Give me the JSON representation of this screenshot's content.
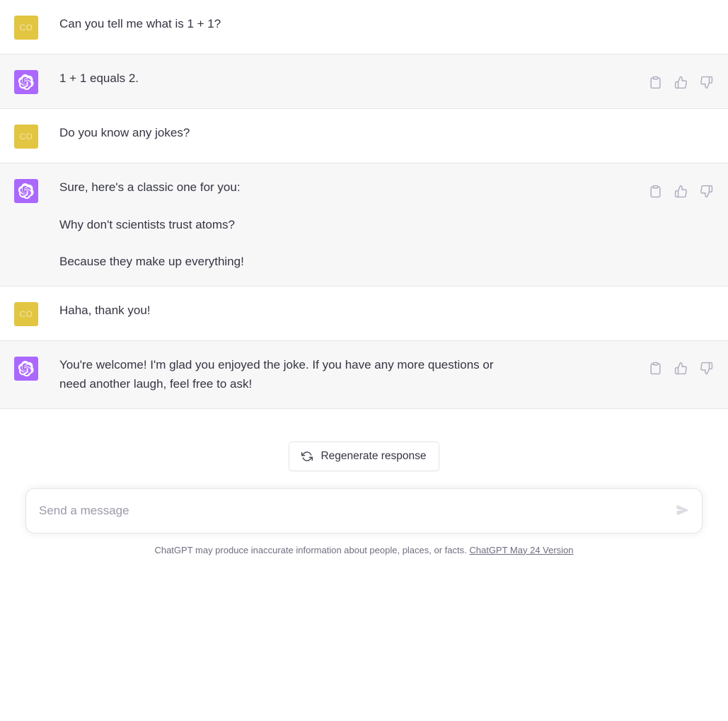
{
  "conversation": {
    "messages": [
      {
        "role": "user",
        "avatar_initials": "CO",
        "avatar_name": "user-avatar",
        "paragraphs": [
          "Can you tell me what is 1 + 1?"
        ]
      },
      {
        "role": "assistant",
        "avatar_name": "chatgpt-avatar",
        "paragraphs": [
          "1 + 1 equals 2."
        ]
      },
      {
        "role": "user",
        "avatar_initials": "CO",
        "avatar_name": "user-avatar",
        "paragraphs": [
          "Do you know any jokes?"
        ]
      },
      {
        "role": "assistant",
        "avatar_name": "chatgpt-avatar",
        "paragraphs": [
          "Sure, here's a classic one for you:",
          "Why don't scientists trust atoms?",
          "Because they make up everything!"
        ]
      },
      {
        "role": "user",
        "avatar_initials": "CO",
        "avatar_name": "user-avatar",
        "paragraphs": [
          "Haha, thank you!"
        ]
      },
      {
        "role": "assistant",
        "avatar_name": "chatgpt-avatar",
        "paragraphs": [
          "You're welcome! I'm glad you enjoyed the joke. If you have any more questions or need another laugh, feel free to ask!"
        ]
      }
    ],
    "message_actions": [
      {
        "name": "copy-icon",
        "label": "Copy"
      },
      {
        "name": "thumbs-up-icon",
        "label": "Good response"
      },
      {
        "name": "thumbs-down-icon",
        "label": "Bad response"
      }
    ]
  },
  "composer": {
    "regenerate_label": "Regenerate response",
    "regenerate_icon": "refresh-icon",
    "placeholder": "Send a message",
    "value": "",
    "send_icon": "send-icon"
  },
  "footer": {
    "disclaimer": "ChatGPT may produce inaccurate information about people, places, or facts.",
    "version_link": "ChatGPT May 24 Version"
  },
  "colors": {
    "user_avatar_bg": "#e2c541",
    "assistant_avatar_bg": "#ab68ff",
    "assistant_row_bg": "#f7f7f8",
    "user_row_bg": "#ffffff",
    "text": "#343541",
    "muted_text": "#6e6e80",
    "icon": "#acacbe",
    "border": "#e5e5e6"
  }
}
